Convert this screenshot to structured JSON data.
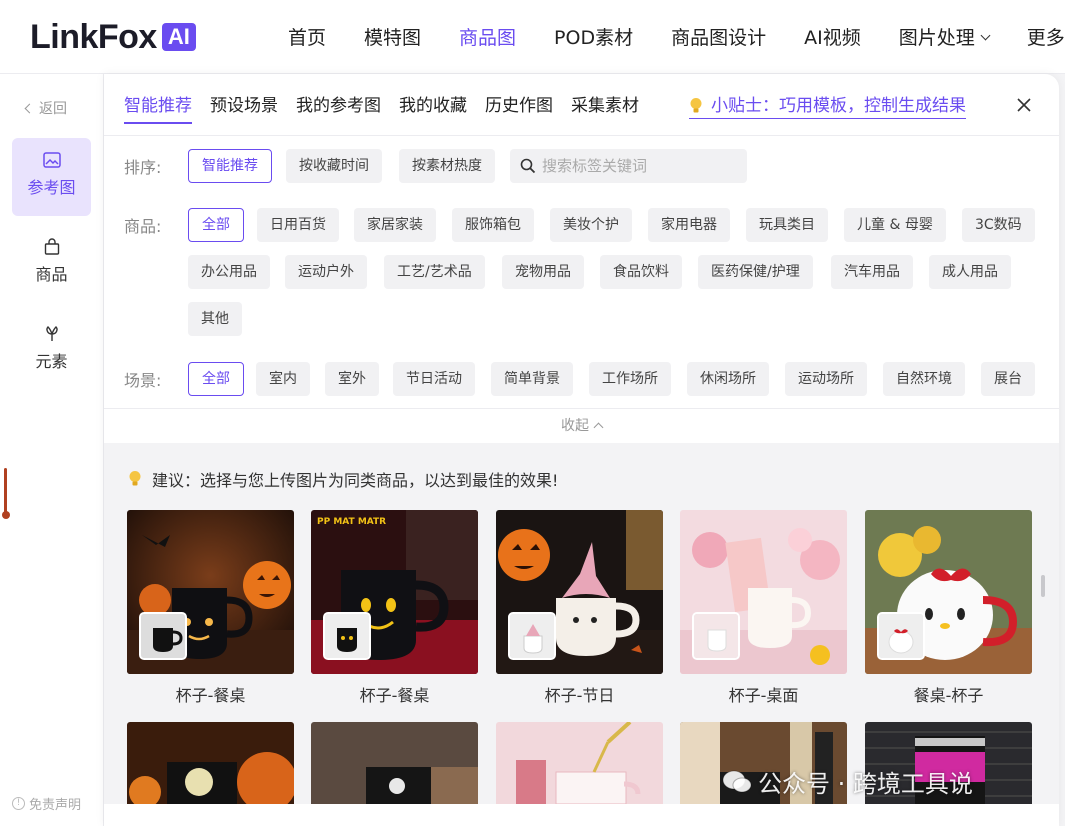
{
  "logo": {
    "text": "LinkFox",
    "badge": "AI"
  },
  "nav": [
    {
      "label": "首页"
    },
    {
      "label": "模特图"
    },
    {
      "label": "商品图"
    },
    {
      "label": "POD素材"
    },
    {
      "label": "商品图设计"
    },
    {
      "label": "AI视频"
    },
    {
      "label": "图片处理"
    },
    {
      "label": "更多"
    }
  ],
  "nav_active": "商品图",
  "sidebar": {
    "back": "返回",
    "items": [
      {
        "label": "参考图",
        "icon": "image-icon"
      },
      {
        "label": "商品",
        "icon": "shopping-bag-icon"
      },
      {
        "label": "元素",
        "icon": "element-icon"
      }
    ],
    "disclaimer": "免责声明"
  },
  "tabs": [
    "智能推荐",
    "预设场景",
    "我的参考图",
    "我的收藏",
    "历史作图",
    "采集素材"
  ],
  "tip": "小贴士：巧用模板，控制生成结果",
  "filters": {
    "sort_label": "排序:",
    "sort_options": [
      "智能推荐",
      "按收藏时间",
      "按素材热度"
    ],
    "search_placeholder": "搜索标签关键词",
    "product_label": "商品:",
    "product_options": [
      "全部",
      "日用百货",
      "家居家装",
      "服饰箱包",
      "美妆个护",
      "家用电器",
      "玩具类目",
      "儿童 & 母婴",
      "3C数码",
      "办公用品",
      "运动户外",
      "工艺/艺术品",
      "宠物用品",
      "食品饮料",
      "医药保健/护理",
      "汽车用品",
      "成人用品",
      "其他"
    ],
    "scene_label": "场景:",
    "scene_options": [
      "全部",
      "室内",
      "室外",
      "节日活动",
      "简单背景",
      "工作场所",
      "休闲场所",
      "运动场所",
      "自然环境",
      "展台"
    ]
  },
  "collapse": "收起",
  "advice": "建议：选择与您上传图片为同类商品，以达到最佳的效果!",
  "cards": [
    {
      "caption": "杯子-餐桌"
    },
    {
      "caption": "杯子-餐桌"
    },
    {
      "caption": "杯子-节日"
    },
    {
      "caption": "杯子-桌面"
    },
    {
      "caption": "餐桌-杯子"
    }
  ],
  "card_mug_text": "PP MAT MATR",
  "watermark": "公众号 · 跨境工具说",
  "colors": {
    "accent": "#6a4cf0",
    "chip_bg": "#f1f1f3"
  }
}
